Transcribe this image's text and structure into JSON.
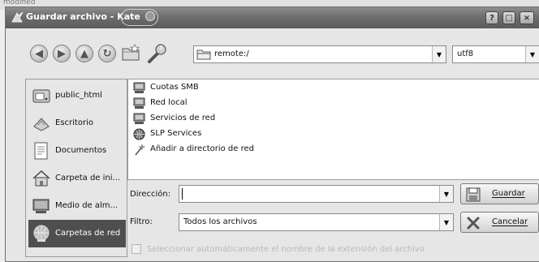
{
  "window": {
    "title": "Guardar archivo - Kate",
    "help_label": "?",
    "maximize_label": "□",
    "close_label": "×"
  },
  "toolbar": {
    "back_glyph": "◀",
    "forward_glyph": "▶",
    "up_glyph": "▲",
    "reload_glyph": "↻",
    "location_value": "remote:/",
    "encoding_value": "utf8"
  },
  "places": [
    {
      "label": "public_html",
      "icon": "drive-icon"
    },
    {
      "label": "Escritorio",
      "icon": "desktop-icon"
    },
    {
      "label": "Documentos",
      "icon": "documents-icon"
    },
    {
      "label": "Carpeta de ini...",
      "icon": "home-icon"
    },
    {
      "label": "Medio de alm...",
      "icon": "storage-icon"
    },
    {
      "label": "Carpetas de red",
      "icon": "network-folder-icon",
      "selected": true
    }
  ],
  "files": [
    {
      "label": "Cuotas SMB",
      "icon": "computer-icon"
    },
    {
      "label": "Red local",
      "icon": "computer-icon"
    },
    {
      "label": "Servicios de red",
      "icon": "computer-icon"
    },
    {
      "label": "SLP Services",
      "icon": "globe-icon"
    },
    {
      "label": "Añadir a directorio de red",
      "icon": "wand-icon"
    }
  ],
  "form": {
    "direccion_label": "Dirección:",
    "direccion_value": "",
    "filtro_label": "Filtro:",
    "filtro_value": "Todos los archivos",
    "guardar_label": "Guardar",
    "cancelar_label": "Cancelar",
    "auto_extension_label": "Seleccionar automáticamente el nombre de la extensión del archivo",
    "auto_extension_checked": false
  },
  "background_text": "modified"
}
